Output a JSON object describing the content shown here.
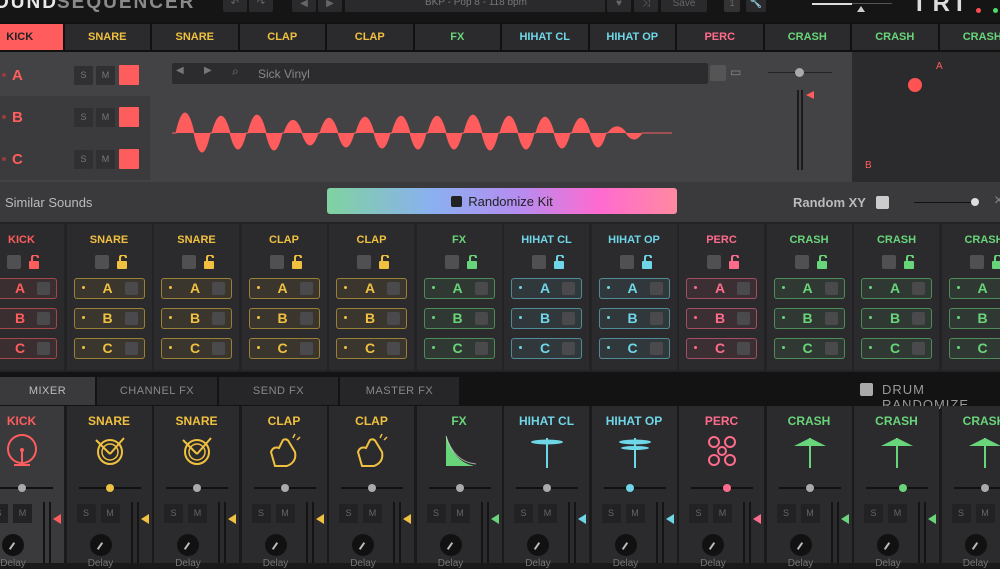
{
  "app": {
    "title_part1": "OUND",
    "title_part2": "SEQUENCER",
    "logo": "TRI"
  },
  "toolbar": {
    "undo": "↶",
    "redo": "↷",
    "prev": "◀",
    "next": "▶",
    "preset": "BKP - Pop 8 - 118 bpm",
    "save_label": "Save",
    "num": "1"
  },
  "tracks": [
    {
      "name": "KICK",
      "color": "#ff5d5d",
      "active": true
    },
    {
      "name": "SNARE",
      "color": "#f0c040"
    },
    {
      "name": "SNARE",
      "color": "#f0c040"
    },
    {
      "name": "CLAP",
      "color": "#f0c040"
    },
    {
      "name": "CLAP",
      "color": "#f0c040"
    },
    {
      "name": "FX",
      "color": "#69d57a"
    },
    {
      "name": "HIHAT CL",
      "color": "#6fd6e8"
    },
    {
      "name": "HIHAT OP",
      "color": "#6fd6e8"
    },
    {
      "name": "PERC",
      "color": "#ff6b8a"
    },
    {
      "name": "CRASH",
      "color": "#69d57a"
    },
    {
      "name": "CRASH",
      "color": "#69d57a"
    },
    {
      "name": "CRASH",
      "color": "#69d57a"
    }
  ],
  "layers": {
    "rows": [
      {
        "label": "A"
      },
      {
        "label": "B"
      },
      {
        "label": "C"
      }
    ],
    "solo": "S",
    "mute": "M"
  },
  "sample": {
    "prev": "◀",
    "next": "▶",
    "name": "Sick Vinyl"
  },
  "xy_pad": {
    "label_a": "A",
    "label_b": "B"
  },
  "randomize": {
    "similar_label": "Similar Sounds",
    "button_label": "Randomize Kit",
    "random_xy_label": "Random XY"
  },
  "grid_letters": [
    "A",
    "B",
    "C"
  ],
  "mixer": {
    "tabs": [
      "MIXER",
      "CHANNEL FX",
      "SEND FX",
      "MASTER FX"
    ],
    "drum_randomizer": "DRUM RANDOMIZE",
    "solo": "S",
    "mute": "M",
    "send_label": "Delay",
    "pan": [
      0.5,
      0.5,
      0.5,
      0.5,
      0.5,
      0.5,
      0.5,
      0.42,
      0.58,
      0.5,
      0.6,
      0.5
    ]
  }
}
